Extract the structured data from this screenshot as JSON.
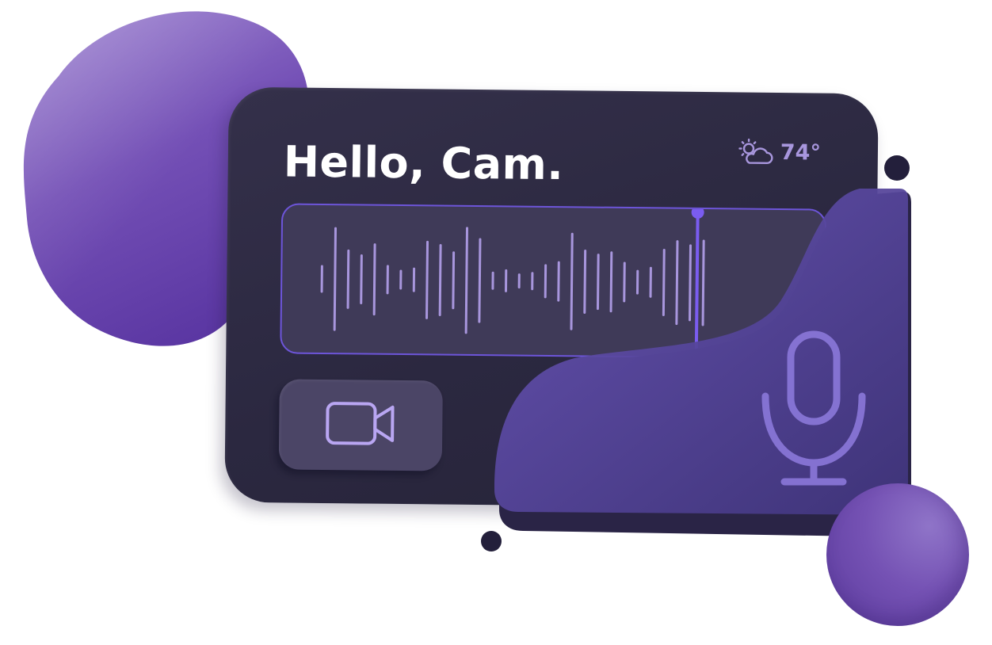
{
  "greeting": "Hello, Cam.",
  "weather": {
    "temperature": "74°",
    "icon": "partly-cloudy-icon"
  },
  "audio": {
    "icon": "waveform-icon",
    "playhead_fraction": 0.78
  },
  "camera_button": {
    "icon": "video-camera-icon"
  },
  "microphone": {
    "icon": "microphone-icon"
  },
  "colors": {
    "card": "#2b2840",
    "accent": "#6d55d9",
    "wave": "#a896dd",
    "blob": "#6a48b2",
    "mic_panel": "#4b3d82"
  }
}
